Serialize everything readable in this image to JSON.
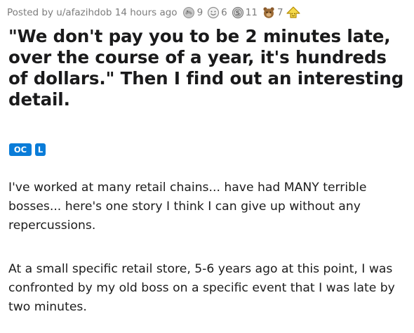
{
  "post": {
    "meta": {
      "posted_by": "Posted by u/afazihdob 14 hours ago",
      "awards": [
        {
          "icon": "silver-award-icon",
          "count": "9"
        },
        {
          "icon": "wholesome-award-icon",
          "count": "6"
        },
        {
          "icon": "coin-award-icon",
          "count": "11"
        },
        {
          "icon": "bear-award-icon",
          "count": "7"
        }
      ],
      "share_icon": "arrow-up-award-icon"
    },
    "title": "\"We don't pay you to be 2 minutes late, over the course of a year, it's hundreds of dollars.\" Then I find out an interesting detail.",
    "flairs": {
      "oc": "OC",
      "l": "L"
    },
    "paragraphs": [
      "I've worked at many retail chains... have had MANY terrible bosses... here's one story I think I can give up without any repercussions.",
      "At a small specific retail store, 5-6 years ago at this point, I was confronted by my old boss on a specific event that I was late by two minutes."
    ],
    "colors": {
      "flair_blue": "#0a7cd8",
      "meta_gray": "#7c7c7c",
      "text": "#1c1c1c"
    }
  }
}
